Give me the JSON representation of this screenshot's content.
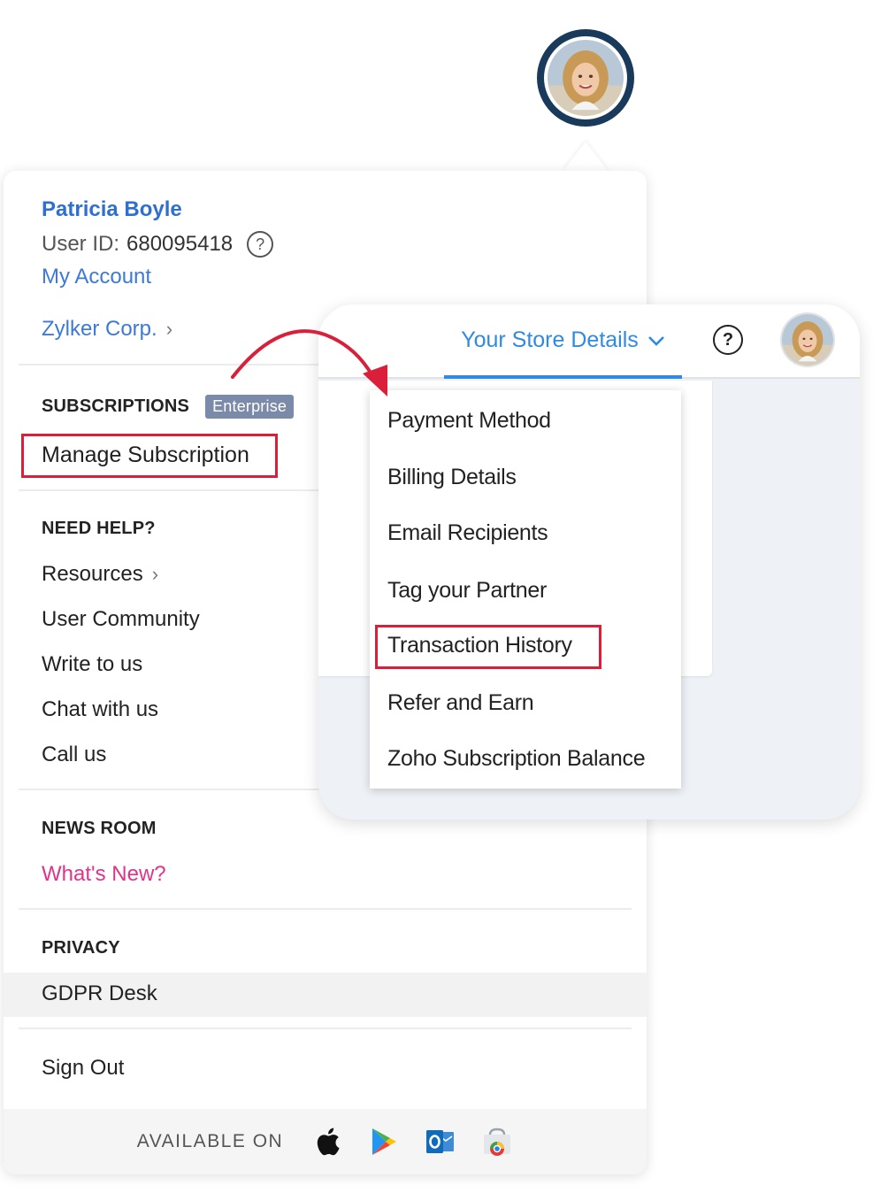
{
  "profile": {
    "name": "Patricia Boyle",
    "user_id_label": "User ID:",
    "user_id": "680095418",
    "help_glyph": "?",
    "my_account": "My Account",
    "organization": "Zylker Corp.",
    "chevron": "›"
  },
  "subscriptions": {
    "title": "SUBSCRIPTIONS",
    "badge": "Enterprise",
    "manage": "Manage Subscription"
  },
  "help": {
    "title": "NEED HELP?",
    "resources": "Resources",
    "community": "User Community",
    "write": "Write to us",
    "chat": "Chat with us",
    "call": "Call us"
  },
  "news": {
    "title": "NEWS ROOM",
    "whats_new": "What's New?"
  },
  "privacy": {
    "title": "PRIVACY",
    "gdpr": "GDPR Desk"
  },
  "sign_out": "Sign Out",
  "footer": {
    "available_on": "AVAILABLE ON",
    "icons": [
      "apple-icon",
      "google-play-icon",
      "outlook-icon",
      "chrome-store-icon"
    ]
  },
  "store": {
    "tab_label": "Your Store Details",
    "help_glyph": "?",
    "menu": [
      "Payment Method",
      "Billing Details",
      "Email Recipients",
      "Tag your Partner",
      "Transaction History",
      "Refer and Earn",
      "Zoho Subscription Balance"
    ]
  },
  "colors": {
    "name_blue": "#2f6fd1",
    "link_blue": "#3d7ad6",
    "tab_blue": "#2f8ae3",
    "highlight_red": "#d91f3a",
    "whats_new_pink": "#e2338a",
    "avatar_ring": "#1a3a5c"
  }
}
